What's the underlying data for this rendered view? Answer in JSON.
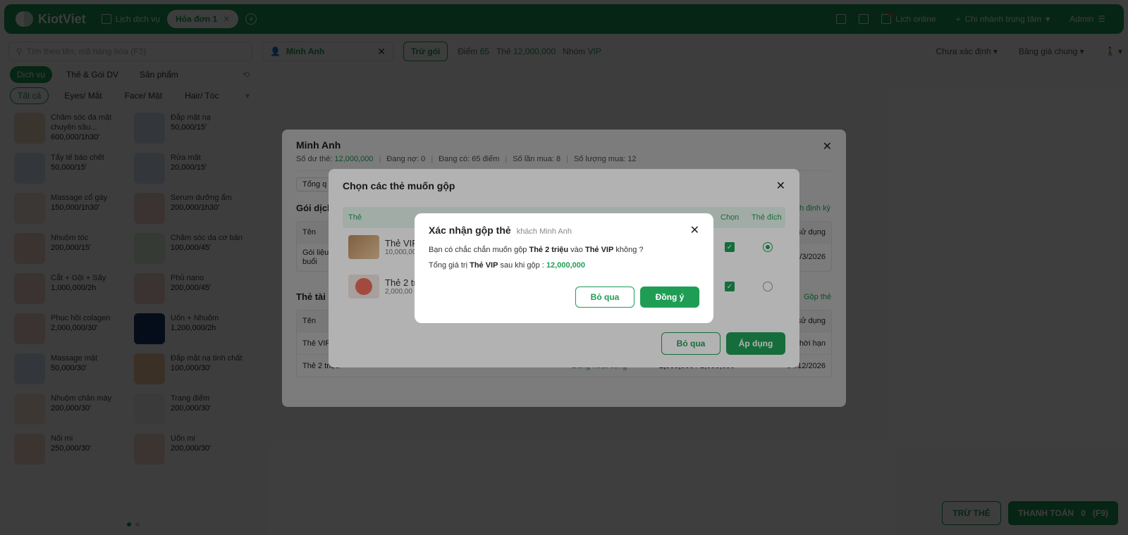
{
  "colors": {
    "brand": "#1f9d55",
    "danger": "#ff4d4f"
  },
  "topbar": {
    "logo": "KiotViet",
    "service_schedule": "Lịch dịch vụ",
    "active_tab": "Hóa đơn 1",
    "online_schedule": "Lịch online",
    "branch": "Chi nhánh trung tâm",
    "user": "Admin"
  },
  "toolbar": {
    "search_placeholder": "Tìm theo tên, mã hàng hóa (F3)",
    "customer_name": "Minh Anh",
    "deduct_button": "Trừ gói",
    "points_label": "Điểm",
    "points_value": "65",
    "card_label": "Thẻ",
    "card_value": "12,000,000",
    "group_label": "Nhóm",
    "group_value": "VIP",
    "status_select": "Chưa xác định",
    "price_list_select": "Bảng giá chung"
  },
  "categories": [
    "Dịch vụ",
    "Thẻ & Gói DV",
    "Sản phẩm"
  ],
  "subcategories": [
    "Tất cả",
    "Eyes/ Mắt",
    "Face/ Mặt",
    "Hair/ Tóc"
  ],
  "products": [
    {
      "name": "Chăm sóc da mặt chuyên sâu...",
      "price": "600,000/1h30'",
      "icon": "face-care-icon",
      "color": "#f3d9c4"
    },
    {
      "name": "Đắp mặt nạ",
      "price": "50,000/15'",
      "icon": "mask-icon",
      "color": "#d7e7f5"
    },
    {
      "name": "Tẩy tế bào chết",
      "price": "50,000/15'",
      "icon": "scrub-icon",
      "color": "#d7e7f5"
    },
    {
      "name": "Rửa mặt",
      "price": "20,000/15'",
      "icon": "wash-icon",
      "color": "#d7e7f5"
    },
    {
      "name": "Massage cổ gáy",
      "price": "150,000/1h30'",
      "icon": "massage-icon",
      "color": "#efe6dc"
    },
    {
      "name": "Serum dưỡng ẩm",
      "price": "200,000/1h30'",
      "icon": "serum-icon",
      "color": "#f1d6cc"
    },
    {
      "name": "Nhuộm tóc",
      "price": "200,000/15'",
      "icon": "hair-dye-icon",
      "color": "#f5d2c8"
    },
    {
      "name": "Chăm sóc da cơ bản",
      "price": "100,000/45'",
      "icon": "skin-care-icon",
      "color": "#dcefd8"
    },
    {
      "name": "Cắt + Gội + Sấy",
      "price": "1,000,000/2h",
      "icon": "haircut-icon",
      "color": "#f1d6cc"
    },
    {
      "name": "Phủ nano",
      "price": "200,000/45'",
      "icon": "nano-icon",
      "color": "#f1d6cc"
    },
    {
      "name": "Phục hồi colagen",
      "price": "2,000,000/30'",
      "icon": "collagen-icon",
      "color": "#f1d6cc"
    },
    {
      "name": "Uốn + Nhuộm",
      "price": "1,200,000/2h",
      "icon": "perm-icon",
      "color": "#1b3d6e"
    },
    {
      "name": "Massage mặt",
      "price": "50,000/30'",
      "icon": "face-massage-icon",
      "color": "#d7e7f5"
    },
    {
      "name": "Đắp mặt nạ tinh chất",
      "price": "100,000/30'",
      "icon": "essence-mask-icon",
      "color": "#f0c79e"
    },
    {
      "name": "Nhuộm chân mày",
      "price": "200,000/30'",
      "icon": "eyebrow-icon",
      "color": "#f6e4d6"
    },
    {
      "name": "Trang điểm",
      "price": "200,000/30'",
      "icon": "makeup-icon",
      "color": "#f2f2f2"
    },
    {
      "name": "Nối mi",
      "price": "250,000/30'",
      "icon": "eyelash-icon",
      "color": "#f6d8cc"
    },
    {
      "name": "Uốn mi",
      "price": "200,000/30'",
      "icon": "lash-curl-icon",
      "color": "#f6d8cc"
    }
  ],
  "bottom": {
    "deduct_card": "TRỪ THẺ",
    "pay": "THANH TOÁN",
    "pay_amount": "0",
    "pay_shortcut": "(F9)"
  },
  "customer_modal": {
    "title": "Minh Anh",
    "balance_label": "Số dư thẻ:",
    "balance": "12,000,000",
    "debt": "Đang nợ: 0",
    "points": "Đang có: 65 điểm",
    "purchases": "Số lần mua: 8",
    "quantity": "Số lượng mua: 12",
    "total_chip": "Tổng q",
    "package_section": "Gói dịch",
    "history_link": "h định kỳ",
    "package_header": {
      "name": "Tên",
      "used": "sử dụng"
    },
    "package_row": {
      "name": "Gói liệu\nbuổi",
      "date": "/3/2026"
    },
    "card_section": "Thẻ tài",
    "merge_link": "Gộp thẻ",
    "card_header": {
      "name": "Tên",
      "used": "sử dụng"
    },
    "card_rows": [
      {
        "name": "Thẻ VIP",
        "status": "",
        "value": "",
        "expiry": "hời hạn"
      },
      {
        "name": "Thẻ 2 triệu",
        "status": "Đang hoạt động",
        "value_bold": "2,000,000",
        "value_rest": " / 2,000,000",
        "expiry": "04/12/2026"
      }
    ]
  },
  "merge_modal": {
    "title": "Chọn các thẻ muốn gộp",
    "col_card": "Thẻ",
    "col_select": "Chọn",
    "col_target": "Thẻ đích",
    "rows": [
      {
        "name": "Thẻ VIP",
        "price": "10,000,00",
        "selected": true,
        "target": true
      },
      {
        "name": "Thẻ 2 tri",
        "price": "2,000,00",
        "selected": true,
        "target": false
      }
    ],
    "skip": "Bỏ qua",
    "apply": "Áp dụng"
  },
  "confirm_modal": {
    "title": "Xác nhận gộp thẻ",
    "subtitle": "khách Minh Anh",
    "q_prefix": "Bạn có chắc chắn muốn gộp ",
    "q_source": "Thẻ 2 triệu",
    "q_mid": " vào ",
    "q_target": "Thẻ VIP",
    "q_suffix": " không ?",
    "t_prefix": "Tổng giá trị ",
    "t_card": "Thẻ VIP",
    "t_mid": " sau khi gộp : ",
    "t_value": "12,000,000",
    "skip": "Bỏ qua",
    "ok": "Đồng ý"
  }
}
